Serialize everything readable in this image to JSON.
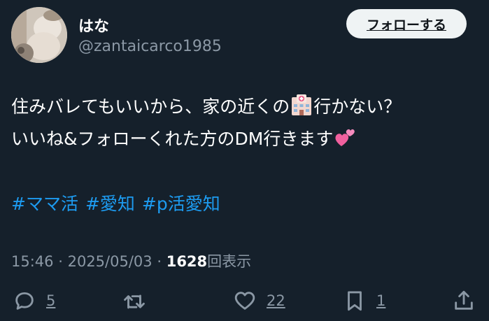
{
  "user": {
    "display_name": "はな",
    "handle": "@zantaicarco1985"
  },
  "follow_button": {
    "label": "フォローする"
  },
  "post": {
    "line1_before": "住みバレてもいいから、家の近くの",
    "line1_after": "行かない？",
    "line2": "いいね&フォローくれた方のDM行きます",
    "hashtags": [
      "#ママ活",
      "#愛知",
      "#p活愛知"
    ]
  },
  "meta": {
    "time": "15:46",
    "separator": "·",
    "date": "2025/05/03",
    "views_count": "1628",
    "views_label": "回表示"
  },
  "actions": {
    "reply_count": "5",
    "retweet_count": "",
    "like_count": "22",
    "bookmark_count": "1"
  },
  "icons": {
    "inline_emoji_1": "hospital-icon",
    "inline_emoji_2": "two-hearts-icon",
    "reply": "reply-icon",
    "retweet": "retweet-icon",
    "like": "heart-icon",
    "bookmark": "bookmark-icon",
    "share": "share-icon"
  },
  "colors": {
    "background": "#15202b",
    "secondary_text": "#8b98a5",
    "hashtag": "#1d9bf0",
    "button_bg": "#eff3f4"
  }
}
